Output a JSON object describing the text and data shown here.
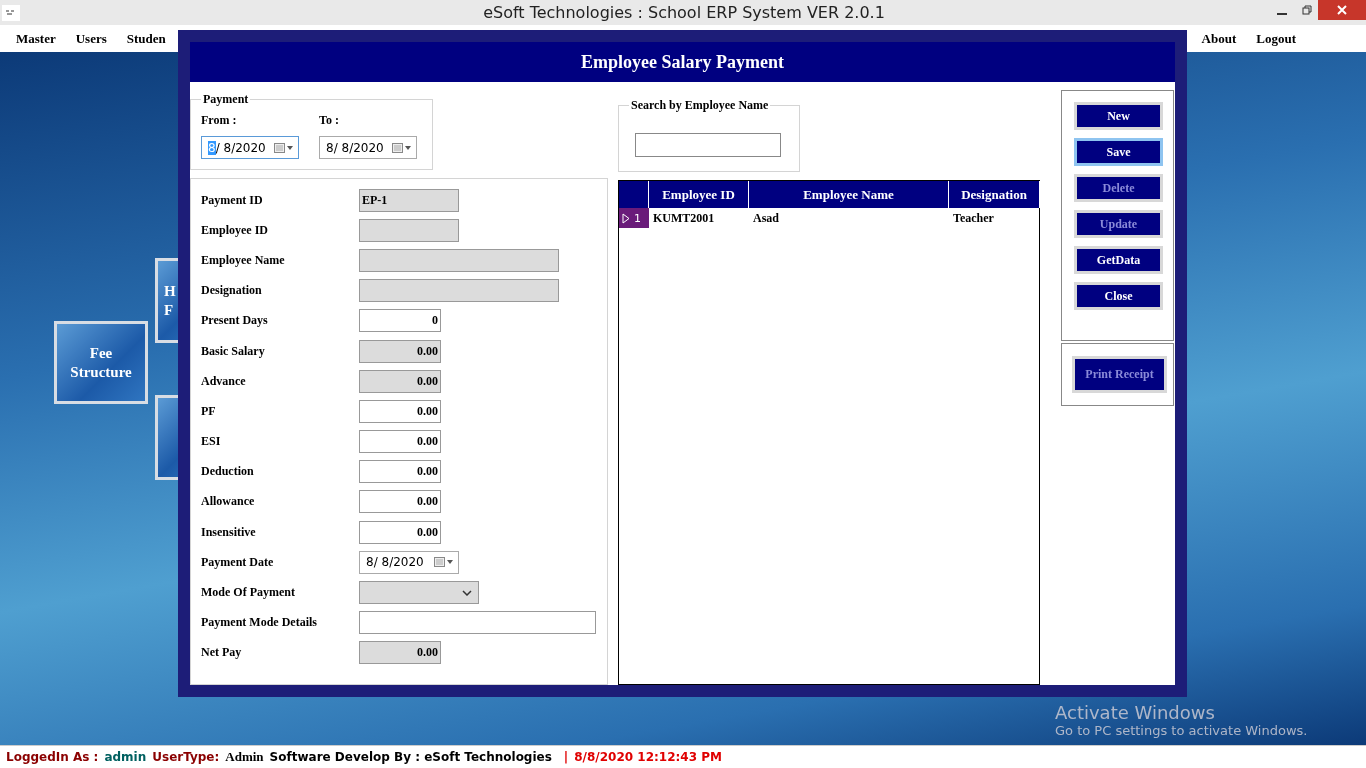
{
  "window": {
    "title": "eSoft Technologies : School ERP System VER 2.0.1"
  },
  "menu": {
    "left": [
      {
        "label": "Master"
      },
      {
        "label": "Users"
      },
      {
        "label": "Studen"
      }
    ],
    "right": [
      {
        "label": "About"
      },
      {
        "label": "Logout"
      }
    ]
  },
  "tiles": [
    {
      "kind": "labelled",
      "lines": [
        "H",
        "F"
      ]
    },
    {
      "kind": "labelled",
      "lines": [
        "Fee",
        "Structure"
      ]
    },
    {
      "kind": "plain"
    }
  ],
  "dialog": {
    "title": "Employee Salary Payment",
    "payment": {
      "legend": "Payment",
      "from": {
        "label": "From :",
        "value": "8/  8/2020",
        "focused": true
      },
      "to": {
        "label": "To :",
        "value": "8/  8/2020",
        "focused": false
      }
    },
    "search": {
      "legend": "Search by Employee Name"
    },
    "fields": [
      {
        "label": "Payment ID",
        "kind": "short",
        "value": "EP-1",
        "readonly": true
      },
      {
        "label": "Employee ID",
        "kind": "short",
        "readonly": true
      },
      {
        "label": "Employee Name",
        "kind": "long",
        "readonly": true
      },
      {
        "label": "Designation",
        "kind": "long",
        "readonly": true
      },
      {
        "label": "Present Days",
        "kind": "amount",
        "value": "0",
        "readonly": false
      },
      {
        "label": "Basic Salary",
        "kind": "amount",
        "value": "0.00",
        "readonly": true
      },
      {
        "label": "Advance",
        "kind": "amount",
        "value": "0.00",
        "readonly": true
      },
      {
        "label": "PF",
        "kind": "amount",
        "value": "0.00",
        "readonly": false
      },
      {
        "label": "ESI",
        "kind": "amount",
        "value": "0.00",
        "readonly": false
      },
      {
        "label": "Deduction",
        "kind": "amount",
        "value": "0.00",
        "readonly": false
      },
      {
        "label": "Allowance",
        "kind": "amount",
        "value": "0.00",
        "readonly": false
      },
      {
        "label": "Insensitive",
        "kind": "amount",
        "value": "0.00",
        "readonly": false
      },
      {
        "label": "Payment Date",
        "kind": "date",
        "value": "8/  8/2020",
        "readonly": false
      },
      {
        "label": "Mode Of Payment",
        "kind": "select",
        "readonly": true
      },
      {
        "label": "Payment Mode Details",
        "kind": "details",
        "readonly": false
      },
      {
        "label": "Net Pay",
        "kind": "amount",
        "value": "0.00",
        "readonly": true
      }
    ],
    "table": {
      "columns": [
        "Employee ID",
        "Employee Name",
        "Designation"
      ],
      "rows": [
        {
          "header": "1",
          "selected": true,
          "cells": [
            "KUMT2001",
            "Asad",
            "Teacher"
          ]
        }
      ]
    },
    "buttons": [
      {
        "label": "New",
        "disabled": false,
        "focused": false
      },
      {
        "label": "Save",
        "disabled": false,
        "focused": true
      },
      {
        "label": "Delete",
        "disabled": true,
        "focused": false
      },
      {
        "label": "Update",
        "disabled": true,
        "focused": false
      },
      {
        "label": "GetData",
        "disabled": false,
        "focused": false
      },
      {
        "label": "Close",
        "disabled": false,
        "focused": false
      }
    ],
    "print_button": {
      "label": "Print Receipt",
      "disabled": true
    }
  },
  "activation": {
    "title": "Activate Windows",
    "text": "Go to PC settings to activate Windows."
  },
  "status_bar": {
    "logged_label": "LoggedIn As :",
    "user": "admin",
    "type_label": "UserType:",
    "type": "Admin",
    "developer": "Software Develop By : eSoft Technologies",
    "separator": "|",
    "datetime": "8/8/2020 12:12:43 PM"
  }
}
